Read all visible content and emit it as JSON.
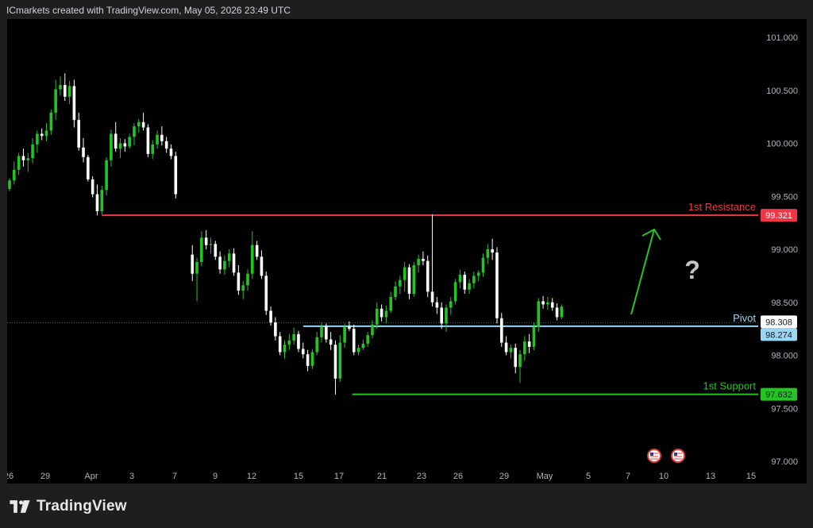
{
  "header": {
    "credit": "ICmarkets created with TradingView.com, May 05, 2026 23:49 UTC"
  },
  "footer": {
    "brand": "TradingView"
  },
  "chart_data": {
    "type": "candlestick",
    "y_axis": {
      "ticks": [
        "101.000",
        "100.500",
        "100.000",
        "99.500",
        "99.000",
        "98.500",
        "98.000",
        "97.500",
        "97.000"
      ],
      "tick_values": [
        101.0,
        100.5,
        100.0,
        99.5,
        99.0,
        98.5,
        98.0,
        97.5,
        97.0
      ],
      "ylim": [
        96.95,
        101.1
      ]
    },
    "x_axis": {
      "ticks": [
        "26",
        "29",
        "Apr",
        "3",
        "7",
        "9",
        "12",
        "15",
        "17",
        "21",
        "23",
        "26",
        "29",
        "May",
        "5",
        "7",
        "10",
        "13",
        "15"
      ]
    },
    "levels": {
      "resistance": {
        "label": "1st Resistance",
        "value": 99.321,
        "value_label": "99.321",
        "color": "#f23645"
      },
      "pivot": {
        "label": "Pivot",
        "value": 98.274,
        "value_label": "98.274",
        "color": "#9bd7f2"
      },
      "support": {
        "label": "1st Support",
        "value": 97.632,
        "value_label": "97.632",
        "color": "#22c522"
      },
      "current_price": {
        "value": 98.308,
        "value_label": "98.308"
      }
    },
    "annotation": {
      "question_mark": "?",
      "arrow_direction": "up"
    },
    "event_icons": [
      "us-flag-icon",
      "us-flag-icon"
    ],
    "colors": {
      "up": "#22c522",
      "down": "#ffffff"
    },
    "candles": [
      {
        "o": 99.57,
        "h": 99.67,
        "l": 99.55,
        "c": 99.65
      },
      {
        "o": 99.65,
        "h": 99.83,
        "l": 99.61,
        "c": 99.75
      },
      {
        "o": 99.75,
        "h": 99.91,
        "l": 99.7,
        "c": 99.88
      },
      {
        "o": 99.88,
        "h": 99.95,
        "l": 99.78,
        "c": 99.84
      },
      {
        "o": 99.84,
        "h": 99.91,
        "l": 99.73,
        "c": 99.86
      },
      {
        "o": 99.86,
        "h": 100.05,
        "l": 99.81,
        "c": 99.99
      },
      {
        "o": 99.99,
        "h": 100.12,
        "l": 99.91,
        "c": 100.09
      },
      {
        "o": 100.09,
        "h": 100.14,
        "l": 100.03,
        "c": 100.07
      },
      {
        "o": 100.07,
        "h": 100.19,
        "l": 100.02,
        "c": 100.12
      },
      {
        "o": 100.12,
        "h": 100.32,
        "l": 100.08,
        "c": 100.29
      },
      {
        "o": 100.29,
        "h": 100.6,
        "l": 100.22,
        "c": 100.51
      },
      {
        "o": 100.51,
        "h": 100.63,
        "l": 100.45,
        "c": 100.55
      },
      {
        "o": 100.55,
        "h": 100.66,
        "l": 100.4,
        "c": 100.44
      },
      {
        "o": 100.44,
        "h": 100.59,
        "l": 100.37,
        "c": 100.54
      },
      {
        "o": 100.54,
        "h": 100.6,
        "l": 100.15,
        "c": 100.22
      },
      {
        "o": 100.22,
        "h": 100.29,
        "l": 99.93,
        "c": 99.96
      },
      {
        "o": 99.96,
        "h": 100.05,
        "l": 99.82,
        "c": 99.87
      },
      {
        "o": 99.87,
        "h": 99.89,
        "l": 99.64,
        "c": 99.66
      },
      {
        "o": 99.66,
        "h": 99.69,
        "l": 99.49,
        "c": 99.52
      },
      {
        "o": 99.52,
        "h": 99.61,
        "l": 99.32,
        "c": 99.36
      },
      {
        "o": 99.36,
        "h": 99.6,
        "l": 99.33,
        "c": 99.56
      },
      {
        "o": 99.56,
        "h": 99.87,
        "l": 99.51,
        "c": 99.84
      },
      {
        "o": 99.84,
        "h": 100.13,
        "l": 99.78,
        "c": 100.09
      },
      {
        "o": 100.09,
        "h": 100.2,
        "l": 99.92,
        "c": 99.95
      },
      {
        "o": 99.95,
        "h": 100.05,
        "l": 99.86,
        "c": 100.0
      },
      {
        "o": 100.0,
        "h": 100.04,
        "l": 99.92,
        "c": 99.97
      },
      {
        "o": 99.97,
        "h": 100.09,
        "l": 99.95,
        "c": 100.06
      },
      {
        "o": 100.06,
        "h": 100.19,
        "l": 99.98,
        "c": 100.16
      },
      {
        "o": 100.16,
        "h": 100.23,
        "l": 100.1,
        "c": 100.2
      },
      {
        "o": 100.2,
        "h": 100.29,
        "l": 100.12,
        "c": 100.15
      },
      {
        "o": 100.15,
        "h": 100.18,
        "l": 99.87,
        "c": 99.9
      },
      {
        "o": 99.9,
        "h": 100.03,
        "l": 99.85,
        "c": 99.99
      },
      {
        "o": 99.99,
        "h": 100.12,
        "l": 99.95,
        "c": 100.08
      },
      {
        "o": 100.08,
        "h": 100.16,
        "l": 99.98,
        "c": 100.02
      },
      {
        "o": 100.02,
        "h": 100.06,
        "l": 99.91,
        "c": 99.95
      },
      {
        "o": 99.95,
        "h": 99.99,
        "l": 99.85,
        "c": 99.88
      },
      {
        "o": 99.88,
        "h": 99.92,
        "l": 99.48,
        "c": 99.52
      },
      {
        "o": 98.95,
        "h": 99.04,
        "l": 98.7,
        "c": 98.77
      },
      {
        "o": 98.77,
        "h": 98.92,
        "l": 98.51,
        "c": 98.88
      },
      {
        "o": 98.88,
        "h": 99.17,
        "l": 98.84,
        "c": 99.11
      },
      {
        "o": 99.11,
        "h": 99.18,
        "l": 99.0,
        "c": 99.04
      },
      {
        "o": 99.04,
        "h": 99.11,
        "l": 98.96,
        "c": 99.05
      },
      {
        "o": 99.05,
        "h": 99.08,
        "l": 98.9,
        "c": 98.93
      },
      {
        "o": 98.93,
        "h": 98.98,
        "l": 98.77,
        "c": 98.81
      },
      {
        "o": 98.81,
        "h": 98.94,
        "l": 98.76,
        "c": 98.89
      },
      {
        "o": 98.89,
        "h": 99.0,
        "l": 98.83,
        "c": 98.96
      },
      {
        "o": 98.96,
        "h": 99.01,
        "l": 98.75,
        "c": 98.78
      },
      {
        "o": 98.78,
        "h": 98.85,
        "l": 98.57,
        "c": 98.61
      },
      {
        "o": 98.61,
        "h": 98.7,
        "l": 98.53,
        "c": 98.66
      },
      {
        "o": 98.66,
        "h": 98.81,
        "l": 98.61,
        "c": 98.77
      },
      {
        "o": 98.77,
        "h": 99.17,
        "l": 98.72,
        "c": 99.04
      },
      {
        "o": 99.04,
        "h": 99.08,
        "l": 98.9,
        "c": 98.93
      },
      {
        "o": 98.93,
        "h": 98.99,
        "l": 98.72,
        "c": 98.75
      },
      {
        "o": 98.75,
        "h": 98.79,
        "l": 98.38,
        "c": 98.42
      },
      {
        "o": 98.42,
        "h": 98.46,
        "l": 98.28,
        "c": 98.31
      },
      {
        "o": 98.31,
        "h": 98.36,
        "l": 98.14,
        "c": 98.18
      },
      {
        "o": 98.18,
        "h": 98.22,
        "l": 98.0,
        "c": 98.03
      },
      {
        "o": 98.03,
        "h": 98.14,
        "l": 97.97,
        "c": 98.1
      },
      {
        "o": 98.1,
        "h": 98.2,
        "l": 98.05,
        "c": 98.14
      },
      {
        "o": 98.14,
        "h": 98.26,
        "l": 98.1,
        "c": 98.2
      },
      {
        "o": 98.2,
        "h": 98.23,
        "l": 98.03,
        "c": 98.06
      },
      {
        "o": 98.06,
        "h": 98.12,
        "l": 97.97,
        "c": 98.01
      },
      {
        "o": 98.01,
        "h": 98.05,
        "l": 97.85,
        "c": 97.9
      },
      {
        "o": 97.9,
        "h": 98.06,
        "l": 97.87,
        "c": 98.03
      },
      {
        "o": 98.03,
        "h": 98.22,
        "l": 98.0,
        "c": 98.17
      },
      {
        "o": 98.17,
        "h": 98.31,
        "l": 98.12,
        "c": 98.27
      },
      {
        "o": 98.27,
        "h": 98.3,
        "l": 98.12,
        "c": 98.15
      },
      {
        "o": 98.15,
        "h": 98.22,
        "l": 98.05,
        "c": 98.1
      },
      {
        "o": 98.1,
        "h": 98.14,
        "l": 97.63,
        "c": 97.78
      },
      {
        "o": 97.78,
        "h": 98.19,
        "l": 97.75,
        "c": 98.12
      },
      {
        "o": 98.12,
        "h": 98.3,
        "l": 98.07,
        "c": 98.27
      },
      {
        "o": 98.27,
        "h": 98.32,
        "l": 98.23,
        "c": 98.25
      },
      {
        "o": 98.25,
        "h": 98.29,
        "l": 98.0,
        "c": 98.03
      },
      {
        "o": 98.03,
        "h": 98.1,
        "l": 98.0,
        "c": 98.07
      },
      {
        "o": 98.07,
        "h": 98.15,
        "l": 98.05,
        "c": 98.11
      },
      {
        "o": 98.11,
        "h": 98.22,
        "l": 98.08,
        "c": 98.19
      },
      {
        "o": 98.19,
        "h": 98.33,
        "l": 98.16,
        "c": 98.29
      },
      {
        "o": 98.29,
        "h": 98.5,
        "l": 98.25,
        "c": 98.44
      },
      {
        "o": 98.44,
        "h": 98.48,
        "l": 98.32,
        "c": 98.36
      },
      {
        "o": 98.36,
        "h": 98.47,
        "l": 98.3,
        "c": 98.42
      },
      {
        "o": 98.42,
        "h": 98.6,
        "l": 98.4,
        "c": 98.55
      },
      {
        "o": 98.55,
        "h": 98.7,
        "l": 98.52,
        "c": 98.65
      },
      {
        "o": 98.65,
        "h": 98.75,
        "l": 98.58,
        "c": 98.71
      },
      {
        "o": 98.71,
        "h": 98.88,
        "l": 98.6,
        "c": 98.83
      },
      {
        "o": 98.83,
        "h": 98.86,
        "l": 98.53,
        "c": 98.58
      },
      {
        "o": 98.58,
        "h": 98.88,
        "l": 98.55,
        "c": 98.85
      },
      {
        "o": 98.85,
        "h": 98.95,
        "l": 98.78,
        "c": 98.91
      },
      {
        "o": 98.91,
        "h": 98.98,
        "l": 98.85,
        "c": 98.89
      },
      {
        "o": 98.89,
        "h": 98.94,
        "l": 98.55,
        "c": 98.6
      },
      {
        "o": 98.6,
        "h": 99.33,
        "l": 98.46,
        "c": 98.5
      },
      {
        "o": 98.5,
        "h": 98.55,
        "l": 98.39,
        "c": 98.45
      },
      {
        "o": 98.45,
        "h": 98.5,
        "l": 98.25,
        "c": 98.3
      },
      {
        "o": 98.3,
        "h": 98.48,
        "l": 98.22,
        "c": 98.45
      },
      {
        "o": 98.45,
        "h": 98.55,
        "l": 98.38,
        "c": 98.51
      },
      {
        "o": 98.51,
        "h": 98.72,
        "l": 98.48,
        "c": 98.69
      },
      {
        "o": 98.69,
        "h": 98.81,
        "l": 98.63,
        "c": 98.76
      },
      {
        "o": 98.76,
        "h": 98.79,
        "l": 98.58,
        "c": 98.62
      },
      {
        "o": 98.62,
        "h": 98.72,
        "l": 98.58,
        "c": 98.68
      },
      {
        "o": 98.68,
        "h": 98.79,
        "l": 98.63,
        "c": 98.75
      },
      {
        "o": 98.75,
        "h": 98.8,
        "l": 98.7,
        "c": 98.78
      },
      {
        "o": 98.78,
        "h": 98.96,
        "l": 98.74,
        "c": 98.92
      },
      {
        "o": 98.92,
        "h": 99.05,
        "l": 98.86,
        "c": 99.0
      },
      {
        "o": 99.0,
        "h": 99.1,
        "l": 98.9,
        "c": 98.97
      },
      {
        "o": 98.97,
        "h": 99.02,
        "l": 98.3,
        "c": 98.35
      },
      {
        "o": 98.35,
        "h": 98.4,
        "l": 98.08,
        "c": 98.12
      },
      {
        "o": 98.12,
        "h": 98.18,
        "l": 98.0,
        "c": 98.03
      },
      {
        "o": 98.03,
        "h": 98.1,
        "l": 97.97,
        "c": 98.07
      },
      {
        "o": 98.07,
        "h": 98.11,
        "l": 97.83,
        "c": 97.89
      },
      {
        "o": 97.89,
        "h": 98.05,
        "l": 97.74,
        "c": 98.01
      },
      {
        "o": 98.01,
        "h": 98.18,
        "l": 97.95,
        "c": 98.13
      },
      {
        "o": 98.13,
        "h": 98.2,
        "l": 98.02,
        "c": 98.08
      },
      {
        "o": 98.08,
        "h": 98.31,
        "l": 98.05,
        "c": 98.27
      },
      {
        "o": 98.27,
        "h": 98.54,
        "l": 98.22,
        "c": 98.51
      },
      {
        "o": 98.51,
        "h": 98.56,
        "l": 98.44,
        "c": 98.48
      },
      {
        "o": 98.48,
        "h": 98.55,
        "l": 98.43,
        "c": 98.5
      },
      {
        "o": 98.5,
        "h": 98.54,
        "l": 98.42,
        "c": 98.45
      },
      {
        "o": 98.45,
        "h": 98.49,
        "l": 98.33,
        "c": 98.36
      },
      {
        "o": 98.36,
        "h": 98.48,
        "l": 98.34,
        "c": 98.46
      }
    ]
  }
}
